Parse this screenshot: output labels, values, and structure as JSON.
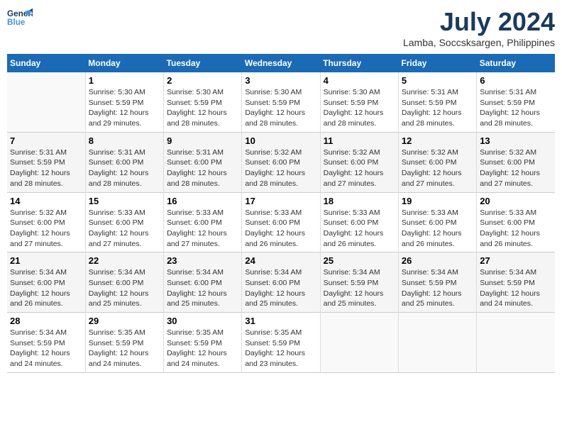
{
  "logo": {
    "line1": "General",
    "line2": "Blue"
  },
  "title": {
    "month_year": "July 2024",
    "location": "Lamba, Soccsksargen, Philippines"
  },
  "days_of_week": [
    "Sunday",
    "Monday",
    "Tuesday",
    "Wednesday",
    "Thursday",
    "Friday",
    "Saturday"
  ],
  "weeks": [
    [
      {
        "day": "",
        "info": ""
      },
      {
        "day": "1",
        "info": "Sunrise: 5:30 AM\nSunset: 5:59 PM\nDaylight: 12 hours\nand 29 minutes."
      },
      {
        "day": "2",
        "info": "Sunrise: 5:30 AM\nSunset: 5:59 PM\nDaylight: 12 hours\nand 28 minutes."
      },
      {
        "day": "3",
        "info": "Sunrise: 5:30 AM\nSunset: 5:59 PM\nDaylight: 12 hours\nand 28 minutes."
      },
      {
        "day": "4",
        "info": "Sunrise: 5:30 AM\nSunset: 5:59 PM\nDaylight: 12 hours\nand 28 minutes."
      },
      {
        "day": "5",
        "info": "Sunrise: 5:31 AM\nSunset: 5:59 PM\nDaylight: 12 hours\nand 28 minutes."
      },
      {
        "day": "6",
        "info": "Sunrise: 5:31 AM\nSunset: 5:59 PM\nDaylight: 12 hours\nand 28 minutes."
      }
    ],
    [
      {
        "day": "7",
        "info": "Sunrise: 5:31 AM\nSunset: 5:59 PM\nDaylight: 12 hours\nand 28 minutes."
      },
      {
        "day": "8",
        "info": "Sunrise: 5:31 AM\nSunset: 6:00 PM\nDaylight: 12 hours\nand 28 minutes."
      },
      {
        "day": "9",
        "info": "Sunrise: 5:31 AM\nSunset: 6:00 PM\nDaylight: 12 hours\nand 28 minutes."
      },
      {
        "day": "10",
        "info": "Sunrise: 5:32 AM\nSunset: 6:00 PM\nDaylight: 12 hours\nand 28 minutes."
      },
      {
        "day": "11",
        "info": "Sunrise: 5:32 AM\nSunset: 6:00 PM\nDaylight: 12 hours\nand 27 minutes."
      },
      {
        "day": "12",
        "info": "Sunrise: 5:32 AM\nSunset: 6:00 PM\nDaylight: 12 hours\nand 27 minutes."
      },
      {
        "day": "13",
        "info": "Sunrise: 5:32 AM\nSunset: 6:00 PM\nDaylight: 12 hours\nand 27 minutes."
      }
    ],
    [
      {
        "day": "14",
        "info": "Sunrise: 5:32 AM\nSunset: 6:00 PM\nDaylight: 12 hours\nand 27 minutes."
      },
      {
        "day": "15",
        "info": "Sunrise: 5:33 AM\nSunset: 6:00 PM\nDaylight: 12 hours\nand 27 minutes."
      },
      {
        "day": "16",
        "info": "Sunrise: 5:33 AM\nSunset: 6:00 PM\nDaylight: 12 hours\nand 27 minutes."
      },
      {
        "day": "17",
        "info": "Sunrise: 5:33 AM\nSunset: 6:00 PM\nDaylight: 12 hours\nand 26 minutes."
      },
      {
        "day": "18",
        "info": "Sunrise: 5:33 AM\nSunset: 6:00 PM\nDaylight: 12 hours\nand 26 minutes."
      },
      {
        "day": "19",
        "info": "Sunrise: 5:33 AM\nSunset: 6:00 PM\nDaylight: 12 hours\nand 26 minutes."
      },
      {
        "day": "20",
        "info": "Sunrise: 5:33 AM\nSunset: 6:00 PM\nDaylight: 12 hours\nand 26 minutes."
      }
    ],
    [
      {
        "day": "21",
        "info": "Sunrise: 5:34 AM\nSunset: 6:00 PM\nDaylight: 12 hours\nand 26 minutes."
      },
      {
        "day": "22",
        "info": "Sunrise: 5:34 AM\nSunset: 6:00 PM\nDaylight: 12 hours\nand 25 minutes."
      },
      {
        "day": "23",
        "info": "Sunrise: 5:34 AM\nSunset: 6:00 PM\nDaylight: 12 hours\nand 25 minutes."
      },
      {
        "day": "24",
        "info": "Sunrise: 5:34 AM\nSunset: 6:00 PM\nDaylight: 12 hours\nand 25 minutes."
      },
      {
        "day": "25",
        "info": "Sunrise: 5:34 AM\nSunset: 5:59 PM\nDaylight: 12 hours\nand 25 minutes."
      },
      {
        "day": "26",
        "info": "Sunrise: 5:34 AM\nSunset: 5:59 PM\nDaylight: 12 hours\nand 25 minutes."
      },
      {
        "day": "27",
        "info": "Sunrise: 5:34 AM\nSunset: 5:59 PM\nDaylight: 12 hours\nand 24 minutes."
      }
    ],
    [
      {
        "day": "28",
        "info": "Sunrise: 5:34 AM\nSunset: 5:59 PM\nDaylight: 12 hours\nand 24 minutes."
      },
      {
        "day": "29",
        "info": "Sunrise: 5:35 AM\nSunset: 5:59 PM\nDaylight: 12 hours\nand 24 minutes."
      },
      {
        "day": "30",
        "info": "Sunrise: 5:35 AM\nSunset: 5:59 PM\nDaylight: 12 hours\nand 24 minutes."
      },
      {
        "day": "31",
        "info": "Sunrise: 5:35 AM\nSunset: 5:59 PM\nDaylight: 12 hours\nand 23 minutes."
      },
      {
        "day": "",
        "info": ""
      },
      {
        "day": "",
        "info": ""
      },
      {
        "day": "",
        "info": ""
      }
    ]
  ]
}
